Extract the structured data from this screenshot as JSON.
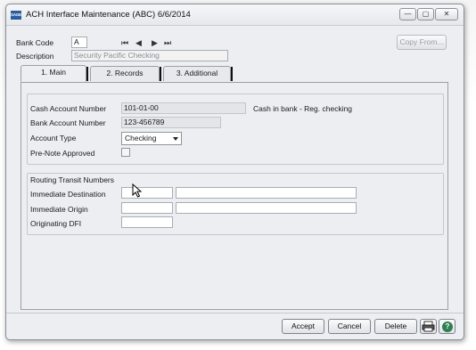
{
  "window": {
    "title": "ACH Interface Maintenance (ABC) 6/6/2014",
    "app_icon_text": "SAGE",
    "minimize_glyph": "—",
    "maximize_glyph": "▢",
    "close_glyph": "✕"
  },
  "header": {
    "bank_code_label": "Bank Code",
    "bank_code_value": "A",
    "description_label": "Description",
    "description_value": "Security Pacific Checking",
    "copy_from_label": "Copy From...",
    "nav_first": "⏮",
    "nav_prev": "◀",
    "nav_next": "▶",
    "nav_last": "⏭"
  },
  "tabs": [
    {
      "label": "1. Main",
      "active": true
    },
    {
      "label": "2. Records",
      "active": false
    },
    {
      "label": "3. Additional",
      "active": false
    }
  ],
  "main": {
    "cash_account_label": "Cash Account Number",
    "cash_account_value": "101-01-00",
    "cash_account_desc": "Cash in bank - Reg. checking",
    "bank_account_label": "Bank Account Number",
    "bank_account_value": "123-456789",
    "account_type_label": "Account Type",
    "account_type_value": "Checking",
    "prenote_label": "Pre-Note Approved",
    "prenote_checked": false,
    "routing_section_label": "Routing Transit Numbers",
    "immediate_destination_label": "Immediate Destination",
    "immediate_destination_value": "",
    "immediate_destination_name": "",
    "immediate_origin_label": "Immediate Origin",
    "immediate_origin_value": "",
    "immediate_origin_name": "",
    "originating_dfi_label": "Originating DFI",
    "originating_dfi_value": ""
  },
  "footer": {
    "accept_label": "Accept",
    "cancel_label": "Cancel",
    "delete_label": "Delete",
    "help_glyph": "?"
  },
  "colors": {
    "window_bg": "#eceef2",
    "help_icon": "#2f7f4f",
    "app_icon": "#2a5d9c"
  }
}
